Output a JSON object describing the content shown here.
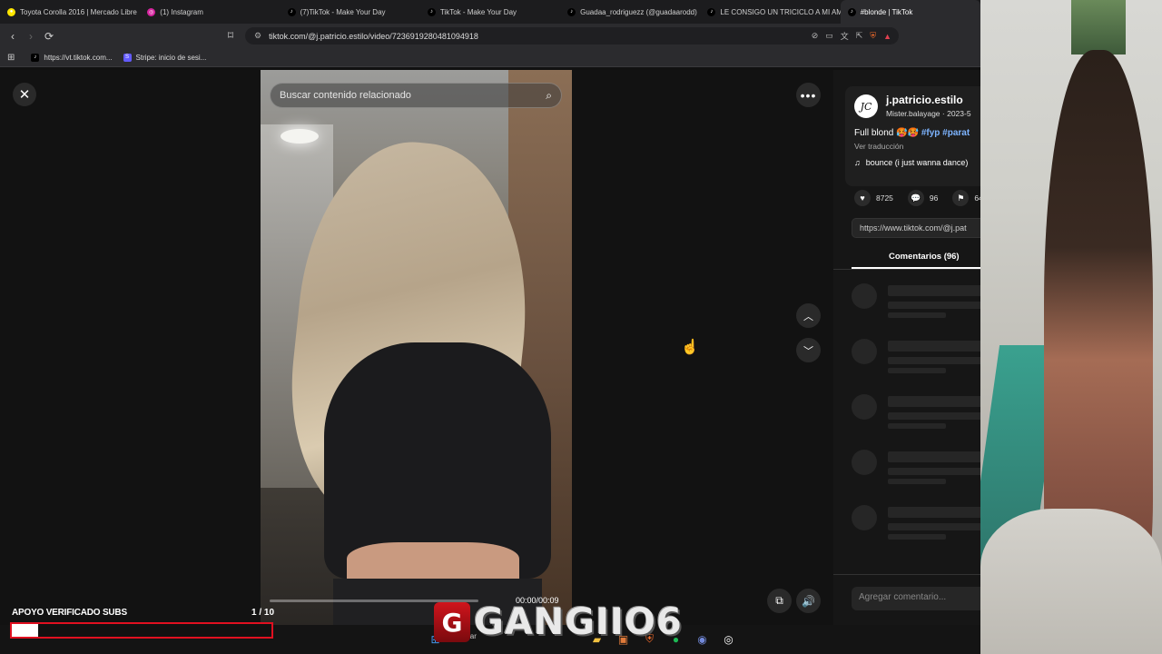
{
  "browser": {
    "tabs": [
      {
        "label": "Toyota Corolla 2016 | Mercado Libre",
        "favicon": "mercadolibre-icon",
        "active": false
      },
      {
        "label": "(1) Instagram",
        "favicon": "instagram-icon",
        "active": false
      },
      {
        "label": "(7)TikTok - Make Your Day",
        "favicon": "tiktok-icon",
        "active": false
      },
      {
        "label": "TikTok - Make Your Day",
        "favicon": "tiktok-icon",
        "active": false
      },
      {
        "label": "Guadaa_rodriguezz (@guadaarodd)",
        "favicon": "tiktok-icon",
        "active": false
      },
      {
        "label": "LE CONSIGO UN TRICICLO A MI AM",
        "favicon": "tiktok-icon",
        "active": false
      },
      {
        "label": "#blonde | TikTok",
        "favicon": "tiktok-icon",
        "active": true
      }
    ],
    "url": "tiktok.com/@j.patricio.estilo/video/7236919280481094918",
    "bookmarks": [
      {
        "label": "https://vt.tiktok.com...",
        "favicon": "tiktok-icon"
      },
      {
        "label": "Stripe: inicio de sesi...",
        "favicon": "stripe-icon"
      }
    ]
  },
  "player": {
    "search_placeholder": "Buscar contenido relacionado",
    "timecode": "00:00/00:09",
    "progress": 0.0
  },
  "post": {
    "username": "j.patricio.estilo",
    "subline": "Mister.balayage · 2023-5",
    "caption_text": "Full blond 🥵🥵",
    "caption_tags": "#fyp #parat",
    "see_translation": "Ver traducción",
    "music": "bounce (i just wanna dance)",
    "likes": "8725",
    "comments": "96",
    "saves": "64",
    "share_link": "https://www.tiktok.com/@j.pat",
    "comments_tab": "Comentarios (96)",
    "add_comment_placeholder": "Agregar comentario..."
  },
  "overlay": {
    "support_label": "APOYO VERIFICADO SUBS",
    "support_count": "1 / 10",
    "support_progress": 0.1,
    "logo_text": "GANGIIO6"
  },
  "taskbar": {
    "search_label": "Buscar"
  },
  "colors": {
    "accent_tag": "#7db4ff",
    "support_border": "#e01020"
  }
}
